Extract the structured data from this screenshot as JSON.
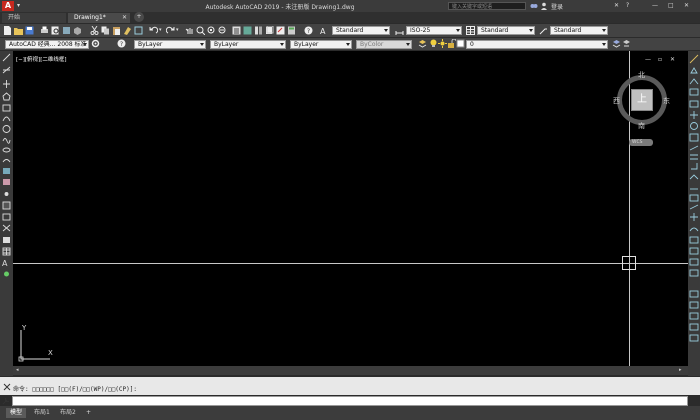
{
  "titlebar": {
    "title": "Autodesk AutoCAD 2019 - 未注册版    Drawing1.dwg",
    "search_placeholder": "键入关键字或短语",
    "user_label": "登录",
    "win_controls": [
      "—",
      "□",
      "✕"
    ],
    "extra": "▾"
  },
  "tabs": {
    "start": "开始",
    "drawing": "Drawing1*",
    "close": "✕",
    "add": "+"
  },
  "toolbar1": {
    "text_style": "Standard",
    "dim_style": "ISO-25",
    "table_style": "Standard",
    "mleader_style": "Standard"
  },
  "toolbar2": {
    "workspace": "AutoCAD 经典... 2008 标准",
    "color": "ByLayer",
    "linetype": "ByLayer",
    "lineweight": "ByLayer",
    "plotstyle": "ByColor",
    "layer": "0"
  },
  "viewport": {
    "label": "[−][俯视][二维线框]",
    "controls": [
      "—",
      "▫",
      "✕"
    ]
  },
  "viewcube": {
    "north": "北",
    "south": "南",
    "east": "东",
    "west": "西",
    "top": "上",
    "wcs": "WCS"
  },
  "ucs": {
    "x": "X",
    "y": "Y"
  },
  "command": {
    "prefix": "命令:",
    "text": "命令: □□□□□□  [□□(F)/□□(WP)/□□(CP)]:"
  },
  "layout_tabs": [
    "模型",
    "布局1",
    "布局2",
    "+"
  ],
  "colors": {
    "background": "#000000",
    "crosshair": "#c8c8c8",
    "title_bar": "#3b3b3b",
    "panel": "#434343",
    "logo": "#c8281e"
  }
}
